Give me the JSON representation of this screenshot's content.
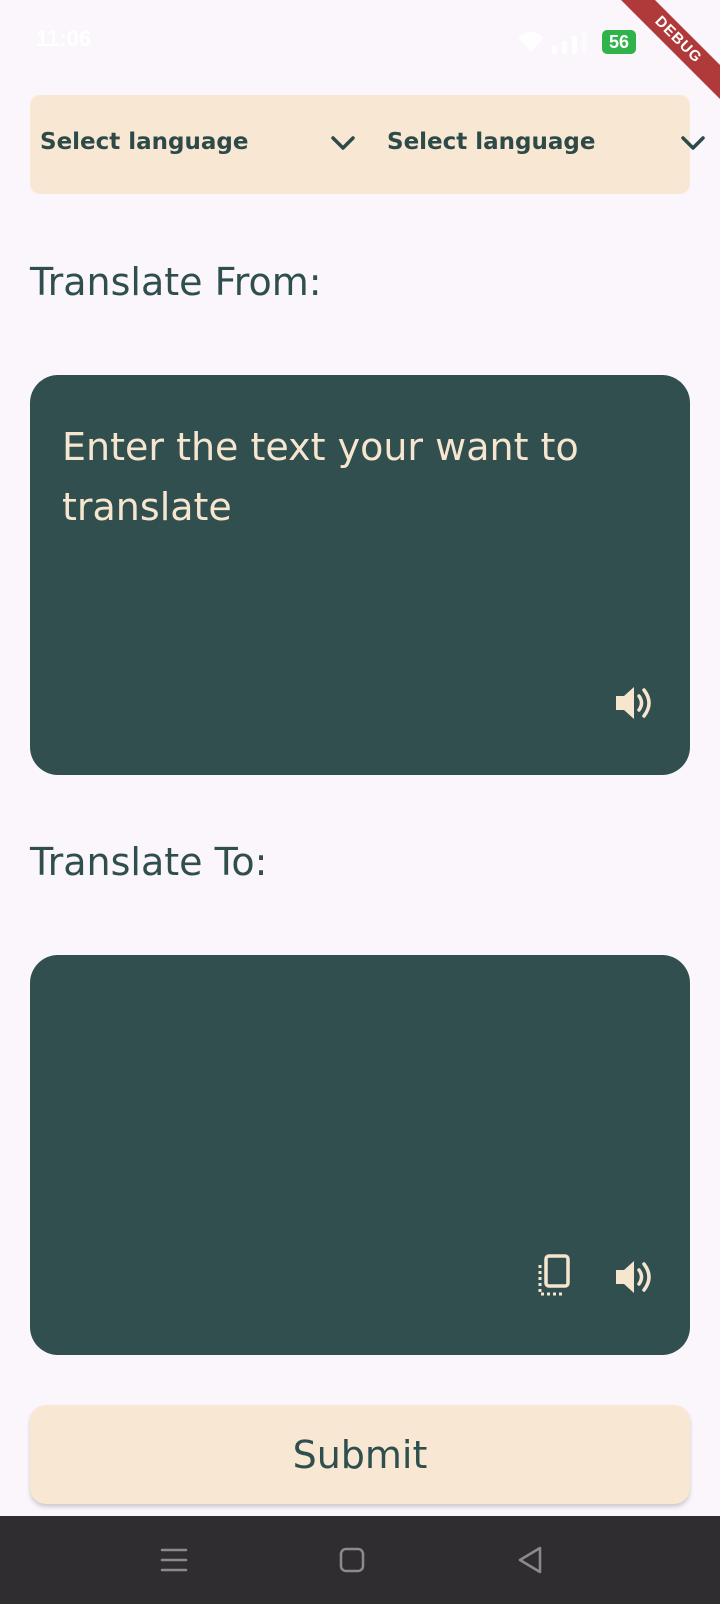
{
  "status_bar": {
    "time": "11:06",
    "battery": "56",
    "icons": [
      "wifi-icon",
      "signal-icon",
      "battery-icon"
    ]
  },
  "debug_banner": "DEBUG",
  "language_selector": {
    "from_label": "Select language",
    "to_label": "Select language"
  },
  "translate_from": {
    "title": "Translate From:",
    "input_value": "",
    "input_placeholder": "Enter the text your want to translate",
    "icons": [
      "speaker-icon"
    ]
  },
  "translate_to": {
    "title": "Translate To:",
    "output_text": "",
    "icons": [
      "copy-icon",
      "speaker-icon"
    ]
  },
  "submit": {
    "label": "Submit"
  },
  "nav_bar": {
    "icons": [
      "menu-icon",
      "home-icon",
      "back-icon"
    ]
  },
  "colors": {
    "background": "#fbf5fc",
    "cream": "#f8e8d3",
    "card": "#314f4f",
    "text_dark": "#2f4f4e",
    "text_light": "#f7e6cf",
    "debug": "#b03a3a",
    "nav_bar": "#302d31"
  }
}
